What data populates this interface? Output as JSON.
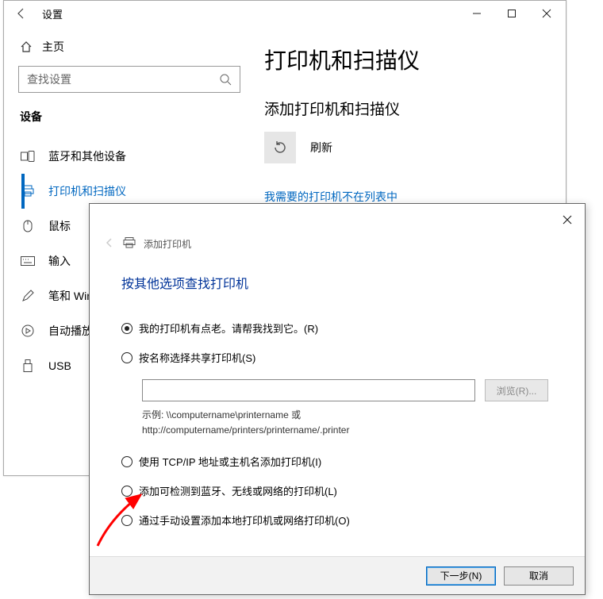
{
  "settings": {
    "title": "设置",
    "home": "主页",
    "searchPlaceholder": "查找设置",
    "section": "设备",
    "nav": [
      {
        "label": "蓝牙和其他设备"
      },
      {
        "label": "打印机和扫描仪"
      },
      {
        "label": "鼠标"
      },
      {
        "label": "输入"
      },
      {
        "label": "笔和 Windows Ink"
      },
      {
        "label": "自动播放"
      },
      {
        "label": "USB"
      }
    ]
  },
  "page": {
    "heading": "打印机和扫描仪",
    "subheading": "添加打印机和扫描仪",
    "refresh": "刷新",
    "link": "我需要的打印机不在列表中"
  },
  "dialog": {
    "breadcrumb": "添加打印机",
    "title": "按其他选项查找打印机",
    "options": [
      "我的打印机有点老。请帮我找到它。(R)",
      "按名称选择共享打印机(S)",
      "使用 TCP/IP 地址或主机名添加打印机(I)",
      "添加可检测到蓝牙、无线或网络的打印机(L)",
      "通过手动设置添加本地打印机或网络打印机(O)"
    ],
    "browse": "浏览(R)...",
    "example1": "示例: \\\\computername\\printername 或",
    "example2": "http://computername/printers/printername/.printer",
    "next": "下一步(N)",
    "cancel": "取消"
  }
}
